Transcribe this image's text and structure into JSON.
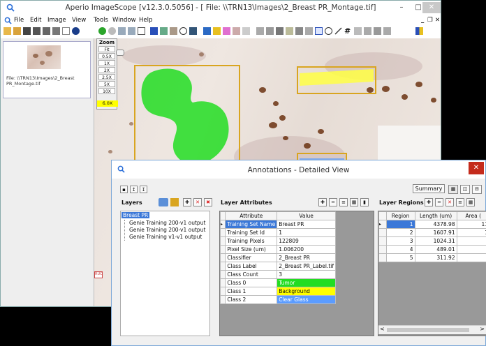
{
  "window": {
    "title": "Aperio ImageScope [v12.3.0.5056] - [ File: \\\\TRN13\\Images\\2_Breast PR_Montage.tif]",
    "minimize": "–",
    "maximize": "□",
    "close": "✕",
    "doc_min": "_",
    "doc_restore": "❐",
    "doc_close": "✕"
  },
  "menu": [
    "File",
    "Edit",
    "Image",
    "View",
    "Tools",
    "Window",
    "Help"
  ],
  "thumbnail": {
    "label": "File: \\\\TRN13\\Images\\2_Breast PR_Montage.tif"
  },
  "zoom": {
    "title": "Zoom",
    "levels": [
      "Fit",
      "0.5X",
      "1X",
      "2X",
      "2.5X",
      "5X",
      "10X"
    ],
    "current": "6.0X"
  },
  "image": {
    "overlay_tag": "RUO",
    "region_colors": {
      "tumor": "#22dd22",
      "background": "#ffff44",
      "clear_glass": "#5b9cff",
      "outline": "#d9a520"
    }
  },
  "dialog": {
    "title": "Annotations - Detailed View",
    "close": "✕",
    "summary_label": "Summary",
    "layers_header": "Layers",
    "layer_attributes_header": "Layer Attributes",
    "layer_regions_header": "Layer Regions",
    "layers": [
      "Breast PR",
      "Genie Training 200-v1 output",
      "Genie Training 200-v1 output",
      "Genie Training v1-v1 output"
    ],
    "attr_columns": [
      "Attribute",
      "Value"
    ],
    "attributes": [
      {
        "name": "Training Set Name",
        "value": "Breast PR"
      },
      {
        "name": "Training Set Id",
        "value": "1"
      },
      {
        "name": "Training Pixels",
        "value": "122809"
      },
      {
        "name": "Pixel Size (um)",
        "value": "1.006200"
      },
      {
        "name": "Classifier",
        "value": "2_Breast PR"
      },
      {
        "name": "Class Label",
        "value": "2_Breast PR_Label.tif"
      },
      {
        "name": "Class Count",
        "value": "3"
      },
      {
        "name": "Class 0",
        "value": "Tumor"
      },
      {
        "name": "Class 1",
        "value": "Background"
      },
      {
        "name": "Class 2",
        "value": "Clear Glass"
      }
    ],
    "region_columns": [
      "Region",
      "Length (um)",
      "Area ("
    ],
    "regions": [
      {
        "region": "1",
        "length": "4378.98",
        "area": "11"
      },
      {
        "region": "2",
        "length": "1607.91",
        "area": "1"
      },
      {
        "region": "3",
        "length": "1024.31",
        "area": ""
      },
      {
        "region": "4",
        "length": "489.01",
        "area": ""
      },
      {
        "region": "5",
        "length": "311.92",
        "area": ""
      }
    ],
    "scroll_left": "<",
    "scroll_right": ">"
  }
}
